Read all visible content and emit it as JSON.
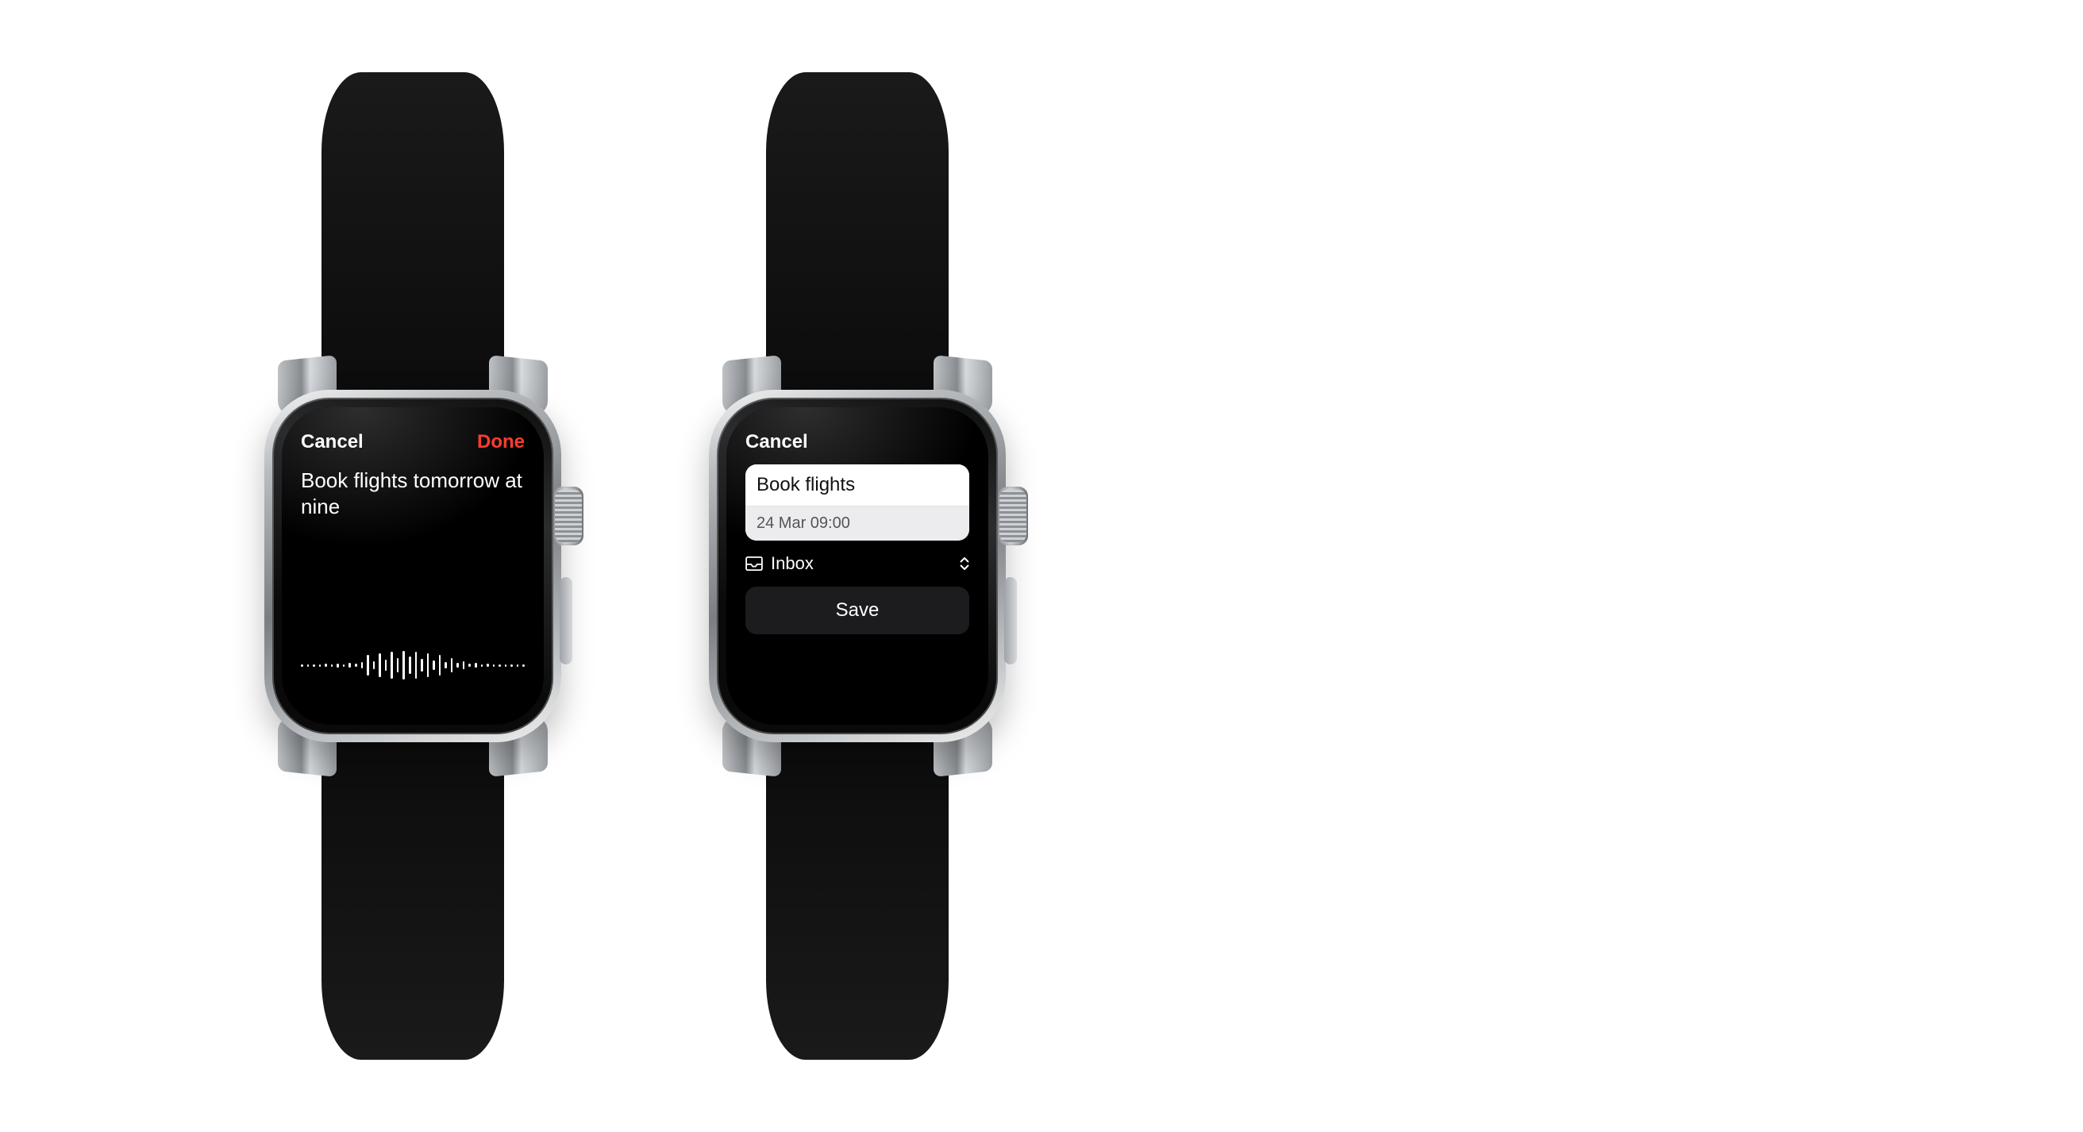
{
  "left": {
    "cancel": "Cancel",
    "done": "Done",
    "dictation_text": "Book flights tomorrow at nine",
    "waveform_heights": [
      3,
      3,
      3,
      3,
      4,
      3,
      5,
      3,
      6,
      4,
      8,
      26,
      10,
      30,
      14,
      34,
      18,
      36,
      22,
      34,
      16,
      30,
      12,
      26,
      8,
      18,
      6,
      10,
      4,
      6,
      3,
      4,
      3,
      3,
      3,
      3,
      3,
      3
    ]
  },
  "right": {
    "cancel": "Cancel",
    "task_title": "Book flights",
    "task_date": "24 Mar 09:00",
    "list_label": "Inbox",
    "save_label": "Save"
  }
}
